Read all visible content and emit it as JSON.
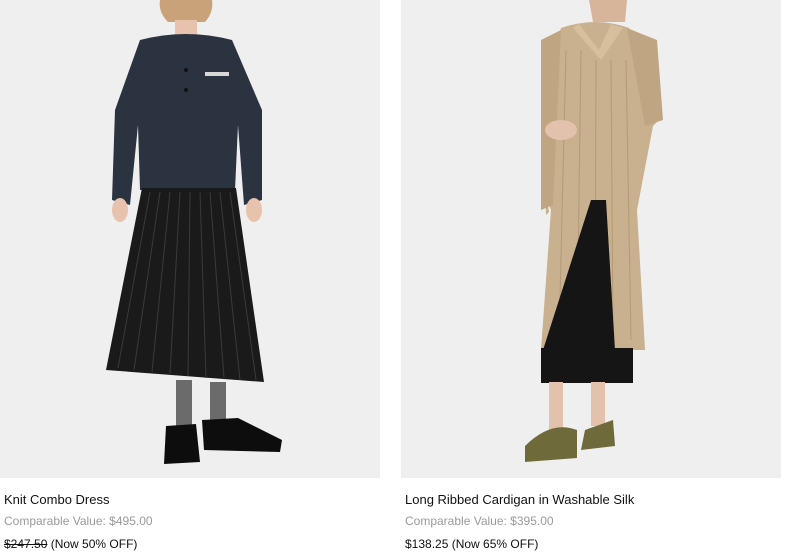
{
  "products": [
    {
      "name": "Knit Combo Dress",
      "comparable_value": "Comparable Value: $495.00",
      "sale_price": "$247.50",
      "discount": " (Now 50% OFF)",
      "image_alt": "Knit Combo Dress product photo",
      "colors": {
        "top": "#2b3340",
        "skirt": "#1a1a1a",
        "socks": "#6b6b6b",
        "shoes": "#0d0d0d"
      }
    },
    {
      "name": "Long Ribbed Cardigan in Washable Silk",
      "comparable_value": "Comparable Value: $395.00",
      "sale_price": "$138.25",
      "discount": " (Now 65% OFF)",
      "image_alt": "Long Ribbed Cardigan in Washable Silk product photo",
      "colors": {
        "cardigan": "#c9b08e",
        "skirt": "#151515",
        "sandals": "#6f6a3a"
      }
    }
  ]
}
